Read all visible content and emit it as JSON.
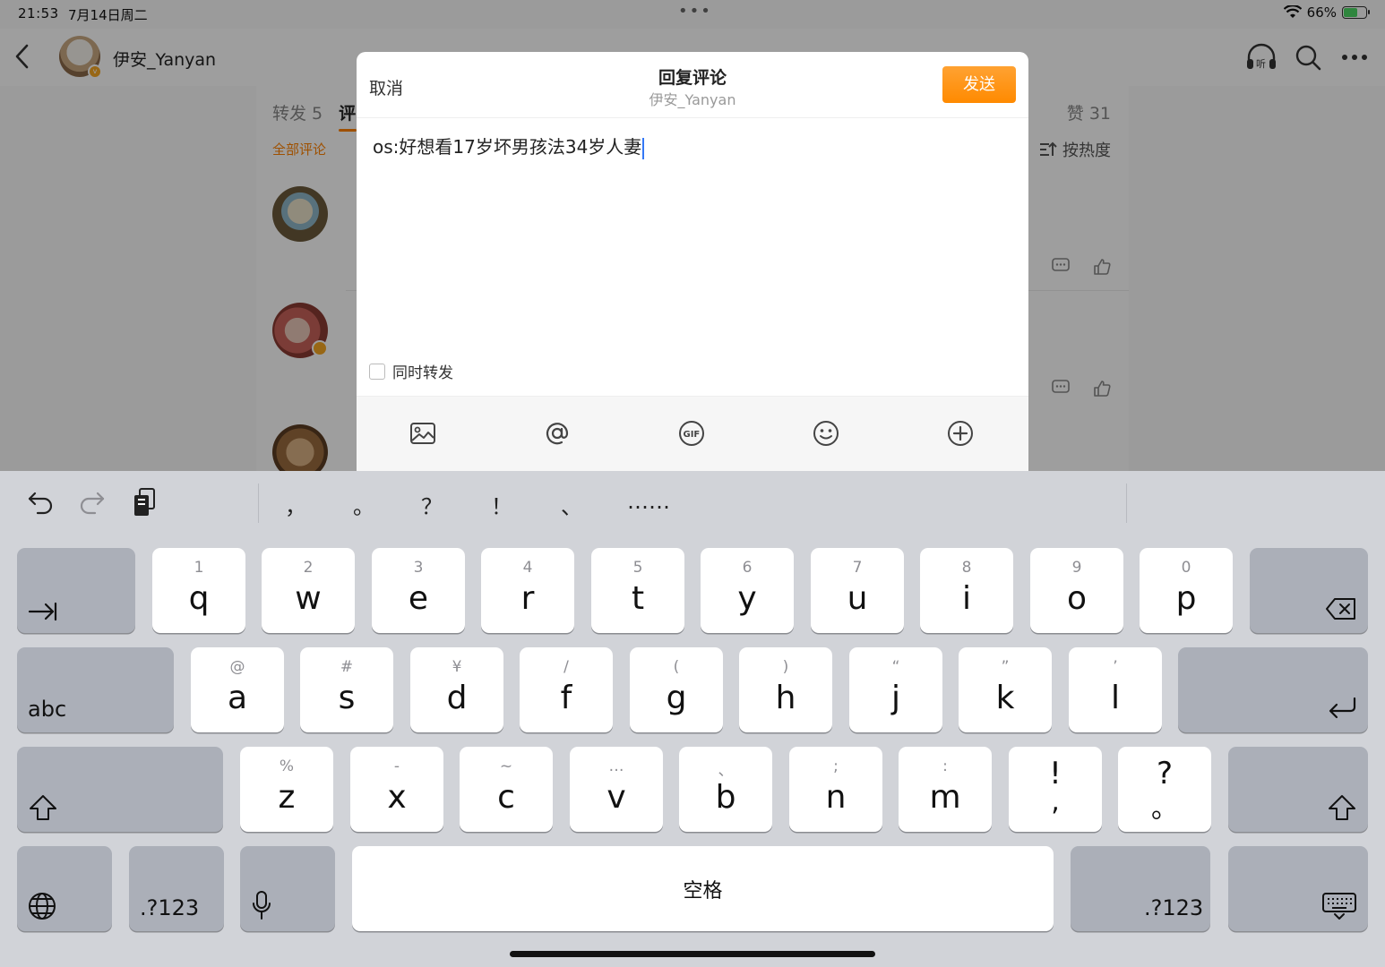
{
  "status_bar": {
    "time": "21:53",
    "date": "7月14日周二",
    "battery": "66%",
    "battery_level": 0.66
  },
  "header": {
    "user_name": "伊安_Yanyan"
  },
  "tabs": {
    "repost": "转发 5",
    "comment": "评",
    "likes": "赞 31"
  },
  "filters": {
    "all_comments": "全部评论",
    "sort": "按热度"
  },
  "modal": {
    "cancel": "取消",
    "title": "回复评论",
    "subtitle": "伊安_Yanyan",
    "send": "发送",
    "text": "os:好想看17岁坏男孩法34岁人妻",
    "repost_label": "同时转发",
    "toolbar": [
      "image-icon",
      "at-icon",
      "gif-icon",
      "emoji-icon",
      "plus-icon"
    ]
  },
  "keyboard": {
    "punctuation": [
      "，",
      "。",
      "？",
      "！",
      "、",
      "……"
    ],
    "row1": [
      {
        "key": "q",
        "hint": "1"
      },
      {
        "key": "w",
        "hint": "2"
      },
      {
        "key": "e",
        "hint": "3"
      },
      {
        "key": "r",
        "hint": "4"
      },
      {
        "key": "t",
        "hint": "5"
      },
      {
        "key": "y",
        "hint": "6"
      },
      {
        "key": "u",
        "hint": "7"
      },
      {
        "key": "i",
        "hint": "8"
      },
      {
        "key": "o",
        "hint": "9"
      },
      {
        "key": "p",
        "hint": "0"
      }
    ],
    "row2": [
      {
        "key": "a",
        "hint": "@"
      },
      {
        "key": "s",
        "hint": "#"
      },
      {
        "key": "d",
        "hint": "¥"
      },
      {
        "key": "f",
        "hint": "/"
      },
      {
        "key": "g",
        "hint": "("
      },
      {
        "key": "h",
        "hint": ")"
      },
      {
        "key": "j",
        "hint": "“"
      },
      {
        "key": "k",
        "hint": "”"
      },
      {
        "key": "l",
        "hint": "’"
      }
    ],
    "row3": [
      {
        "key": "z",
        "hint": "%"
      },
      {
        "key": "x",
        "hint": "-"
      },
      {
        "key": "c",
        "hint": "~"
      },
      {
        "key": "v",
        "hint": "…"
      },
      {
        "key": "b",
        "hint": "、"
      },
      {
        "key": "n",
        "hint": ";"
      },
      {
        "key": "m",
        "hint": ":"
      }
    ],
    "row3_symbols": [
      {
        "top": "!",
        "bottom": ","
      },
      {
        "top": "?",
        "bottom": "。"
      }
    ],
    "abc": "abc",
    "numbers": ".?123",
    "space": "空格"
  },
  "colors": {
    "accent": "#ff8200",
    "caret": "#3478f6"
  }
}
